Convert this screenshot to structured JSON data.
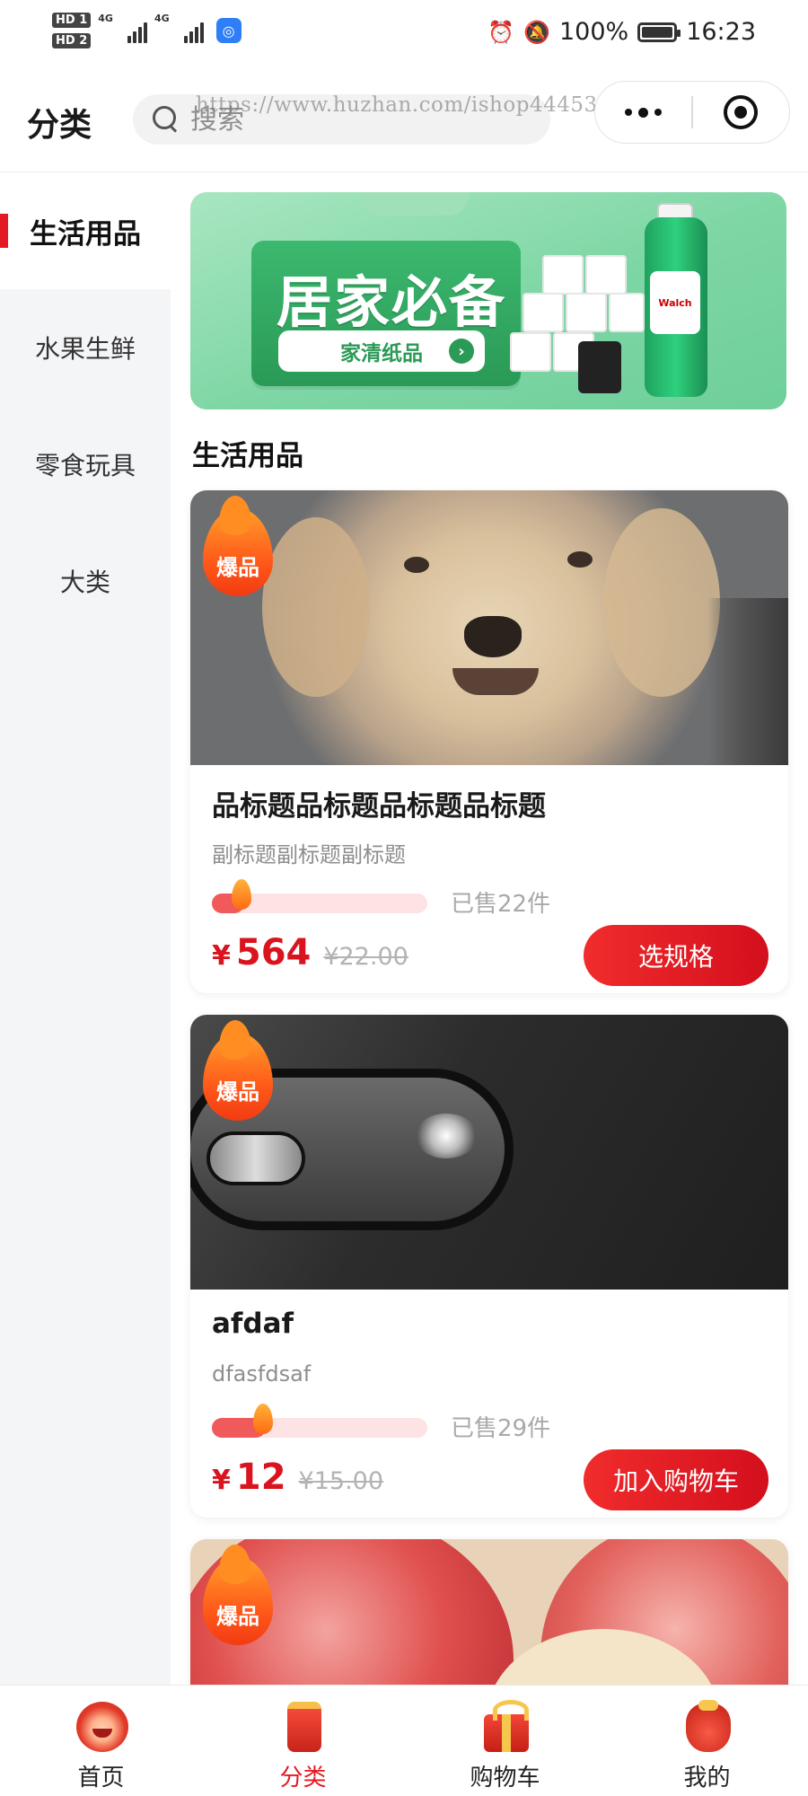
{
  "status_bar": {
    "hd1": "HD 1",
    "hd2": "HD 2",
    "net1": "4G",
    "net2": "4G",
    "battery": "100%",
    "time": "16:23"
  },
  "header": {
    "title": "分类",
    "search_placeholder": "搜索",
    "watermark": "https://www.huzhan.com/ishop44453"
  },
  "sidebar": {
    "items": [
      {
        "label": "生活用品",
        "active": true
      },
      {
        "label": "水果生鲜",
        "active": false
      },
      {
        "label": "零食玩具",
        "active": false
      },
      {
        "label": "大类",
        "active": false
      }
    ]
  },
  "banner": {
    "title": "居家必备",
    "button": "家清纸品",
    "arrow": "›",
    "bottle_brand": "Walch"
  },
  "section_title": "生活用品",
  "products": [
    {
      "badge": "爆品",
      "title": "品标题品标题品标题品标题",
      "subtitle": "副标题副标题副标题",
      "progress": 0.15,
      "sold": "已售22件",
      "currency": "¥",
      "price": "564",
      "original_price": "¥22.00",
      "button": "选规格"
    },
    {
      "badge": "爆品",
      "title": "afdaf",
      "subtitle": "dfasfdsaf",
      "progress": 0.25,
      "sold": "已售29件",
      "currency": "¥",
      "price": "12",
      "original_price": "¥15.00",
      "button": "加入购物车"
    },
    {
      "badge": "爆品"
    }
  ],
  "tabbar": {
    "items": [
      {
        "label": "首页",
        "icon": "lion-head-icon",
        "active": false
      },
      {
        "label": "分类",
        "icon": "category-box-icon",
        "active": true
      },
      {
        "label": "购物车",
        "icon": "gift-box-icon",
        "active": false
      },
      {
        "label": "我的",
        "icon": "lucky-bag-icon",
        "active": false
      }
    ]
  },
  "colors": {
    "accent": "#e21a23",
    "price": "#d9141e",
    "sidebar_bg": "#f4f5f7",
    "banner_green": "#7dd6a4"
  }
}
